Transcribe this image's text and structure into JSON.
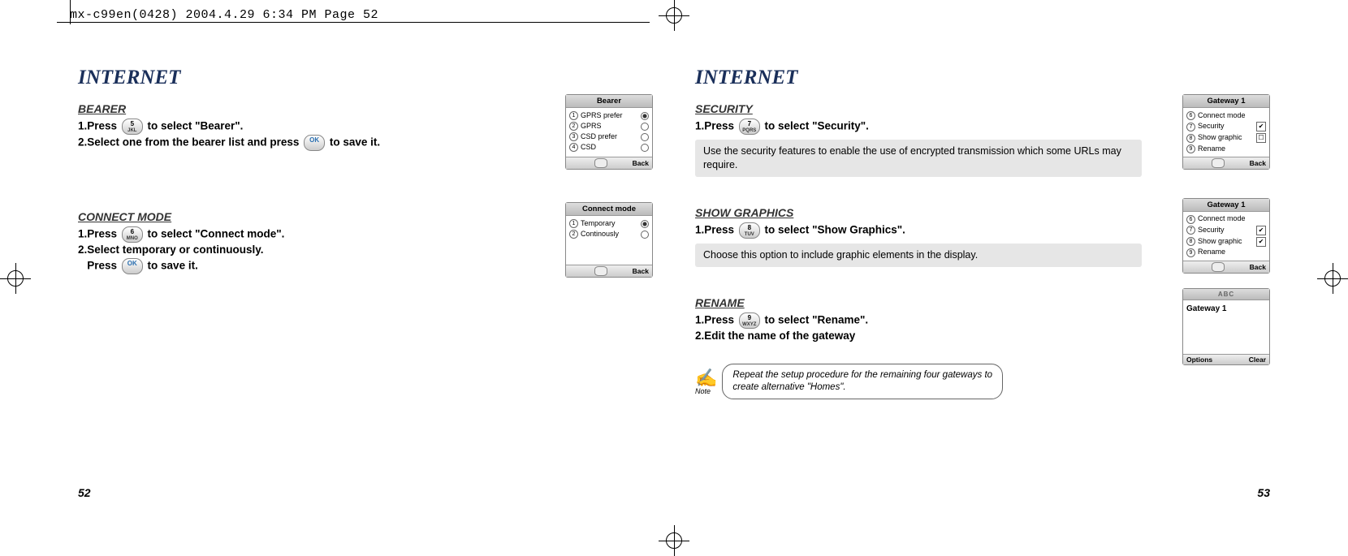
{
  "print_header": "mx-c99en(0428)  2004.4.29  6:34 PM  Page 52",
  "left": {
    "title": "INTERNET",
    "bearer": {
      "heading": "BEARER",
      "step1_a": "1.Press ",
      "step1_key": "5",
      "step1_key_sub": "JKL",
      "step1_b": " to select \"Bearer\".",
      "step2_a": "2.Select one from the bearer list and press ",
      "step2_key": "OK",
      "step2_b": " to save it.",
      "screen": {
        "title": "Bearer",
        "items": [
          {
            "n": "1",
            "label": "GPRS prefer",
            "sel": true
          },
          {
            "n": "2",
            "label": "GPRS",
            "sel": false
          },
          {
            "n": "3",
            "label": "CSD prefer",
            "sel": false
          },
          {
            "n": "4",
            "label": "CSD",
            "sel": false
          }
        ],
        "soft_right": "Back"
      }
    },
    "connect": {
      "heading": "CONNECT MODE",
      "step1_a": "1.Press ",
      "step1_key": "6",
      "step1_key_sub": "MNO",
      "step1_b": " to select \"Connect mode\".",
      "step2": "2.Select  temporary or continuously.",
      "step3_a": "   Press ",
      "step3_key": "OK",
      "step3_b": " to save it.",
      "screen": {
        "title": "Connect mode",
        "items": [
          {
            "n": "1",
            "label": "Temporary",
            "sel": true
          },
          {
            "n": "2",
            "label": "Continously",
            "sel": false
          }
        ],
        "soft_right": "Back"
      }
    },
    "pagenum": "52"
  },
  "right": {
    "title": "INTERNET",
    "security": {
      "heading": "SECURITY",
      "step1_a": "1.Press ",
      "step1_key": "7",
      "step1_key_sub": "PQRS",
      "step1_b": " to select \"Security\".",
      "note": "Use the security features to enable the use of encrypted transmission which some URLs may require.",
      "screen": {
        "title": "Gateway 1",
        "items": [
          {
            "n": "6",
            "label": "Connect mode",
            "state": ""
          },
          {
            "n": "7",
            "label": "Security",
            "state": "✔"
          },
          {
            "n": "8",
            "label": "Show graphic",
            "state": "☐"
          },
          {
            "n": "9",
            "label": "Rename",
            "state": ""
          }
        ],
        "soft_right": "Back"
      }
    },
    "graphics": {
      "heading": "SHOW GRAPHICS",
      "step1_a": "1.Press ",
      "step1_key": "8",
      "step1_key_sub": "TUV",
      "step1_b": " to select \"Show Graphics\".",
      "note": "Choose this option to include graphic elements in the display.",
      "screen": {
        "title": "Gateway 1",
        "items": [
          {
            "n": "6",
            "label": "Connect mode",
            "state": ""
          },
          {
            "n": "7",
            "label": "Security",
            "state": "✔"
          },
          {
            "n": "8",
            "label": "Show graphic",
            "state": "✔"
          },
          {
            "n": "9",
            "label": "Rename",
            "state": ""
          }
        ],
        "soft_right": "Back"
      }
    },
    "rename": {
      "heading": "RENAME",
      "step1_a": "1.Press ",
      "step1_key": "9",
      "step1_key_sub": "WXYZ",
      "step1_b": " to select \"Rename\".",
      "step2": "2.Edit the name of the gateway",
      "screen": {
        "title": "ABC",
        "value": "Gateway 1",
        "soft_left": "Options",
        "soft_right": "Clear"
      }
    },
    "note_callout": "Repeat the setup procedure for the remaining four gateways to create alternative \"Homes\".",
    "note_label": "Note",
    "pagenum": "53"
  }
}
